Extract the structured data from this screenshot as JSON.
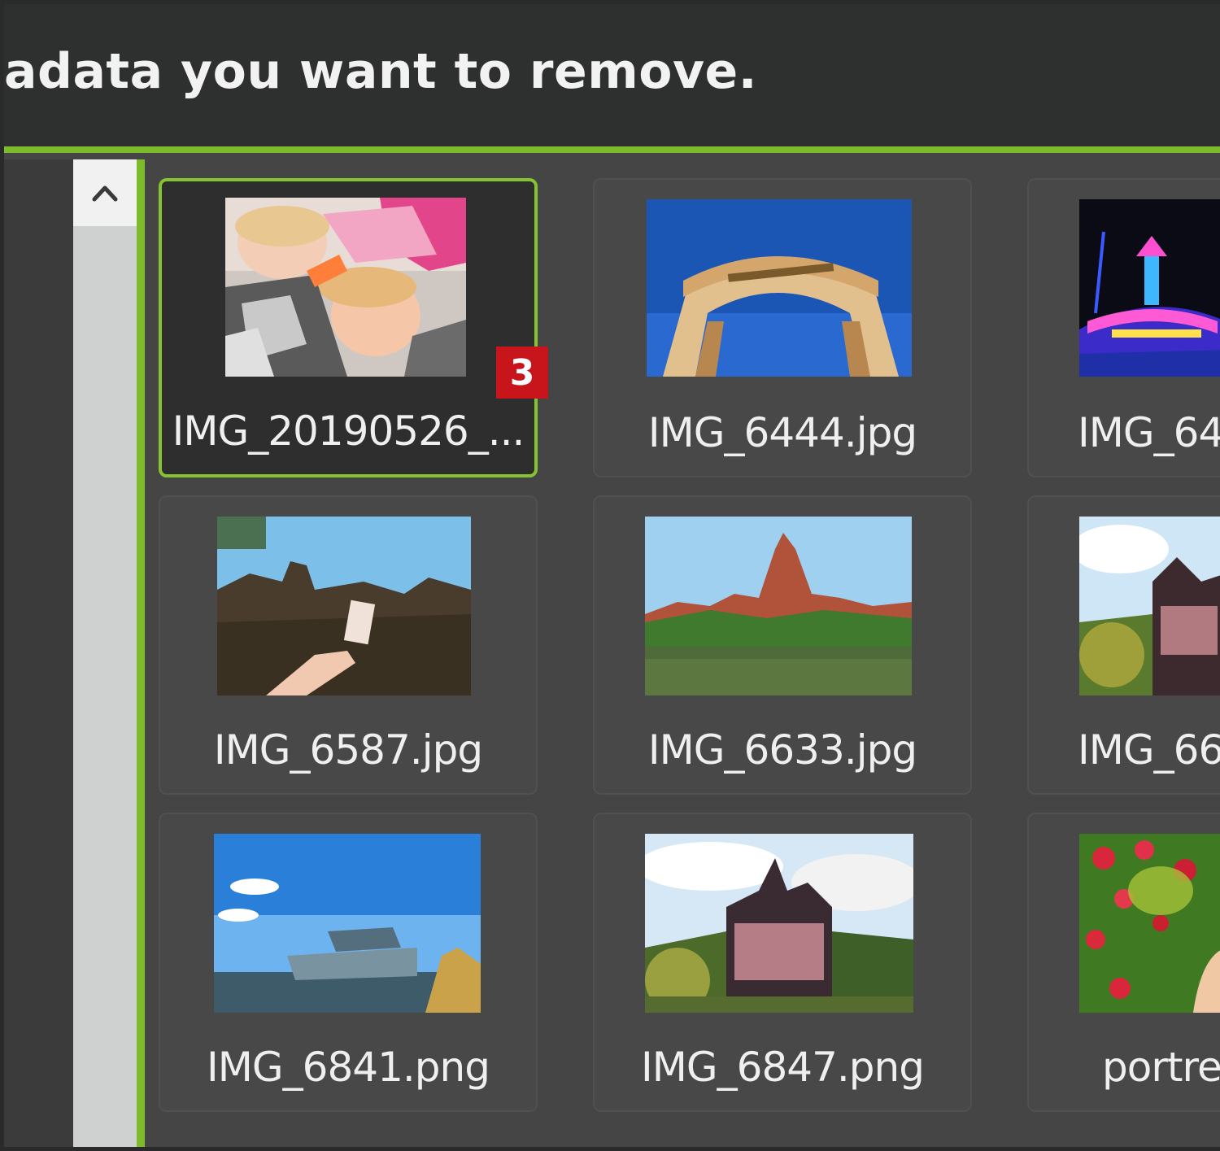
{
  "header": {
    "text": "adata you want to remove."
  },
  "scrollbar": {
    "up_icon": "chevron-up-icon"
  },
  "tiles": [
    {
      "caption": "IMG_20190526_...",
      "selected": true,
      "badge": "3"
    },
    {
      "caption": "IMG_6444.jpg"
    },
    {
      "caption": "IMG_64"
    },
    {
      "caption": "IMG_6587.jpg"
    },
    {
      "caption": "IMG_6633.jpg"
    },
    {
      "caption": "IMG_66"
    },
    {
      "caption": "IMG_6841.png"
    },
    {
      "caption": "IMG_6847.png"
    },
    {
      "caption": "portre"
    }
  ],
  "colors": {
    "accent": "#7dbb2c",
    "badge": "#c8141b",
    "header_bg": "#2e2f2f",
    "tile_bg": "#484848"
  }
}
